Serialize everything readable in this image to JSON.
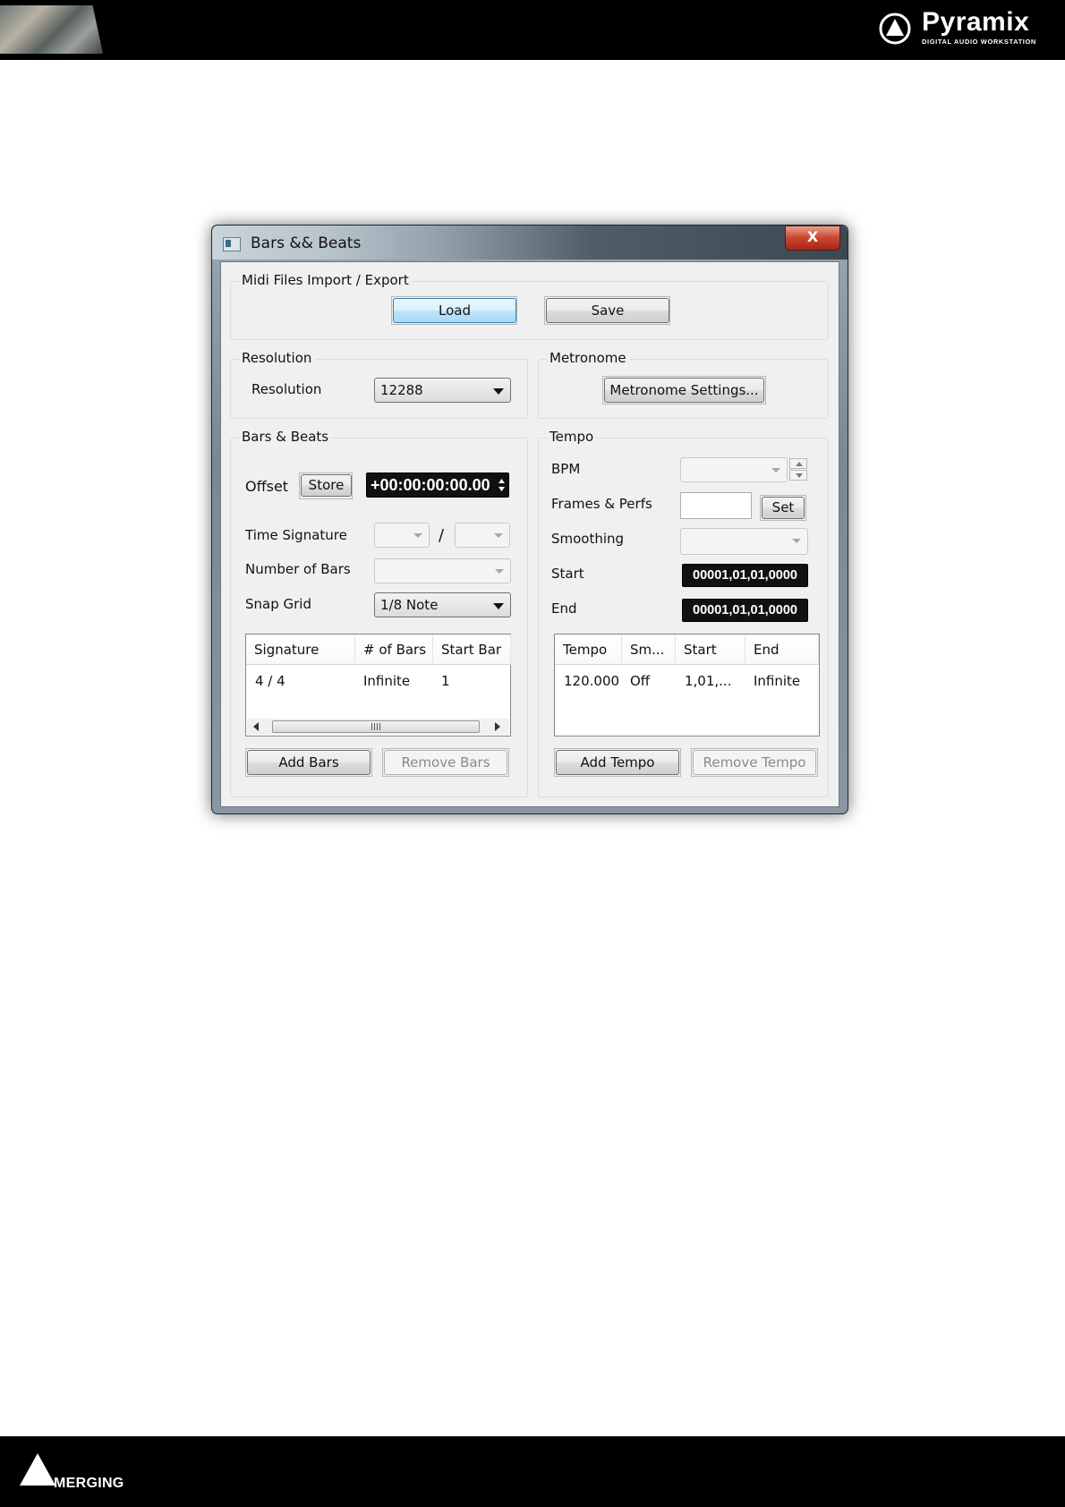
{
  "header": {
    "brand_name": "Pyramix",
    "brand_tagline": "DIGITAL AUDIO WORKSTATION"
  },
  "footer": {
    "brand_name": "MERGING"
  },
  "window": {
    "title": "Bars && Beats",
    "close_label": "X"
  },
  "midi": {
    "group_label": "Midi Files Import / Export",
    "load_label": "Load",
    "save_label": "Save"
  },
  "resolution": {
    "group_label": "Resolution",
    "label": "Resolution",
    "value": "12288"
  },
  "metronome": {
    "group_label": "Metronome",
    "settings_label": "Metronome Settings..."
  },
  "bars_beats": {
    "group_label": "Bars & Beats",
    "offset_label": "Offset",
    "store_label": "Store",
    "offset_value": "+00:00:00:00.00",
    "time_signature_label": "Time Signature",
    "time_signature_separator": "/",
    "number_of_bars_label": "Number of Bars",
    "snap_grid_label": "Snap Grid",
    "snap_grid_value": "1/8 Note",
    "columns": [
      "Signature",
      "# of Bars",
      "Start Bar"
    ],
    "rows": [
      [
        "4 / 4",
        "Infinite",
        "1"
      ]
    ],
    "add_label": "Add Bars",
    "remove_label": "Remove Bars"
  },
  "tempo": {
    "group_label": "Tempo",
    "bpm_label": "BPM",
    "frames_perfs_label": "Frames & Perfs",
    "set_label": "Set",
    "smoothing_label": "Smoothing",
    "start_label": "Start",
    "start_value": "00001,01,01,0000",
    "end_label": "End",
    "end_value": "00001,01,01,0000",
    "columns": [
      "Tempo",
      "Sm...",
      "Start",
      "End"
    ],
    "rows": [
      [
        "120.000",
        "Off",
        "1,01,...",
        "Infinite"
      ]
    ],
    "add_label": "Add Tempo",
    "remove_label": "Remove Tempo"
  },
  "colors": {
    "page_bars": "#000000",
    "dialog_face": "#f0f0f0",
    "lcd_background": "#111111",
    "focus_button": "#3c7fb1"
  }
}
